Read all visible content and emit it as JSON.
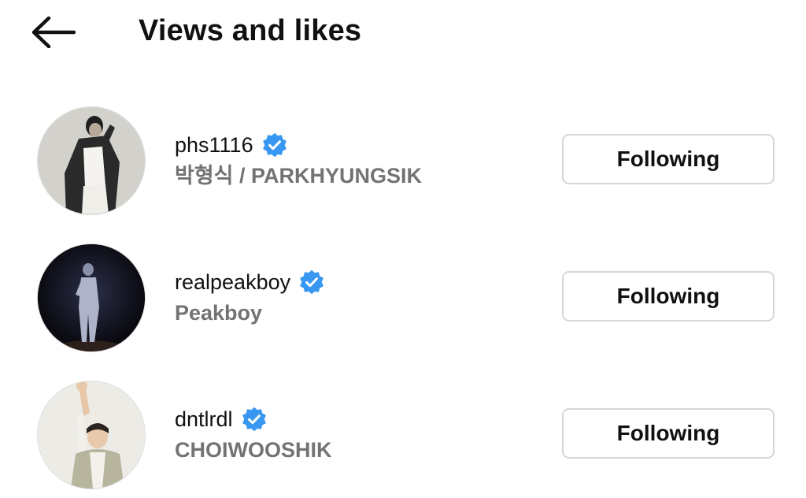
{
  "header": {
    "title": "Views and likes",
    "back_icon": "arrow-left-icon"
  },
  "colors": {
    "verified_badge": "#3897f0",
    "secondary_text": "#737373",
    "button_border": "#d6d6d6"
  },
  "users": [
    {
      "username": "phs1116",
      "full_name": "박형식 / PARKHYUNGSIK",
      "verified": true,
      "button_label": "Following"
    },
    {
      "username": "realpeakboy",
      "full_name": "Peakboy",
      "verified": true,
      "button_label": "Following"
    },
    {
      "username": "dntlrdl",
      "full_name": "CHOIWOOSHIK",
      "verified": true,
      "button_label": "Following"
    }
  ]
}
